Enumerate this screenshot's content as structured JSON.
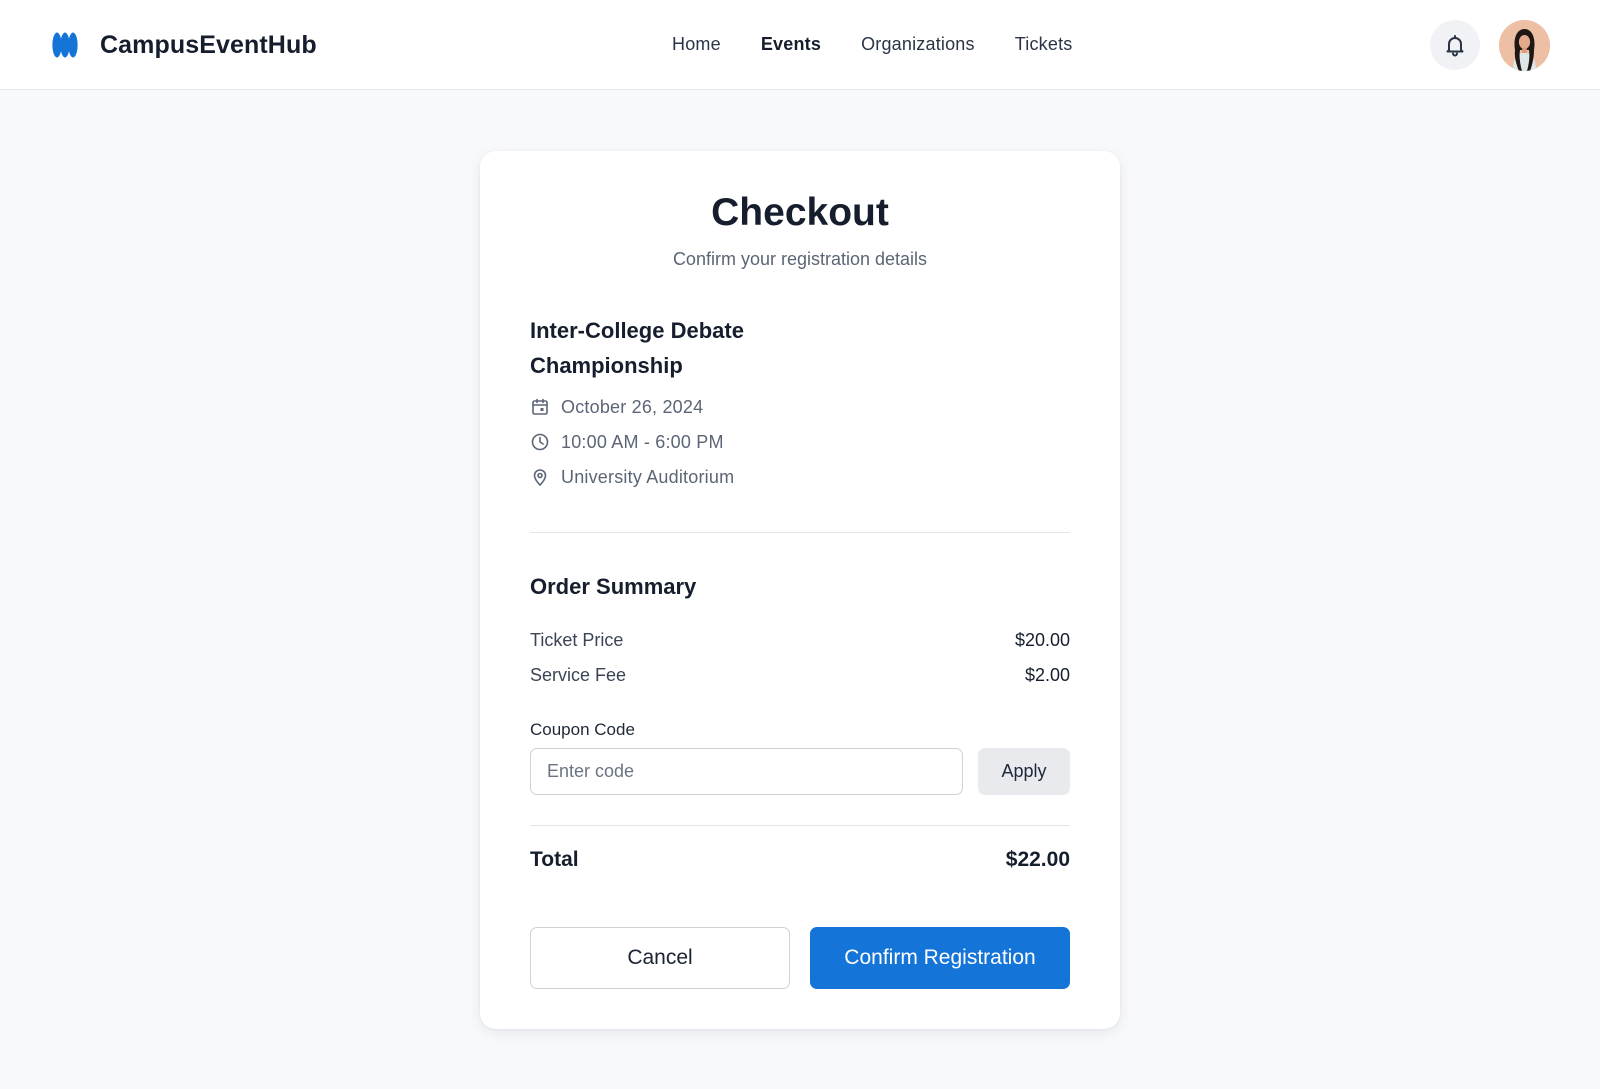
{
  "header": {
    "brand_name": "CampusEventHub",
    "brand_logo_icon": "wave-logo-icon",
    "nav": [
      {
        "label": "Home",
        "active": false
      },
      {
        "label": "Events",
        "active": true
      },
      {
        "label": "Organizations",
        "active": false
      },
      {
        "label": "Tickets",
        "active": false
      }
    ],
    "notification_icon": "bell-icon"
  },
  "checkout": {
    "title": "Checkout",
    "subtitle": "Confirm your registration details",
    "event": {
      "name": "Inter-College Debate Championship",
      "date": "October 26, 2024",
      "time": "10:00 AM - 6:00 PM",
      "location": "University Auditorium",
      "icons": {
        "date": "calendar-icon",
        "time": "clock-icon",
        "location": "map-pin-icon"
      }
    },
    "order_summary": {
      "title": "Order Summary",
      "lines": [
        {
          "label": "Ticket Price",
          "value": "$20.00"
        },
        {
          "label": "Service Fee",
          "value": "$2.00"
        }
      ]
    },
    "coupon": {
      "label": "Coupon Code",
      "placeholder": "Enter code",
      "value": "",
      "apply_label": "Apply"
    },
    "total": {
      "label": "Total",
      "value": "$22.00"
    },
    "actions": {
      "cancel_label": "Cancel",
      "confirm_label": "Confirm Registration"
    }
  },
  "colors": {
    "accent": "#1474d8",
    "background": "#f8f9fb",
    "text_primary": "#161e2e",
    "text_secondary": "#5b6575"
  }
}
